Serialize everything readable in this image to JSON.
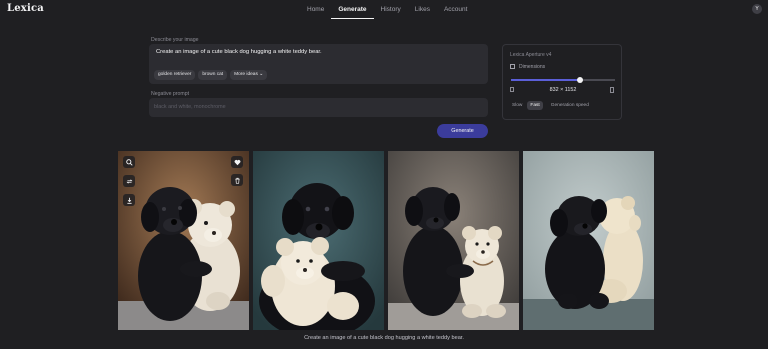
{
  "app": {
    "logo": "Lexica",
    "avatar_initial": "Y"
  },
  "nav": [
    {
      "label": "Home",
      "active": false
    },
    {
      "label": "Generate",
      "active": true
    },
    {
      "label": "History",
      "active": false
    },
    {
      "label": "Likes",
      "active": false
    },
    {
      "label": "Account",
      "active": false
    }
  ],
  "prompt": {
    "label": "Describe your image",
    "value": "Create an image of a cute black dog hugging a white teddy bear.",
    "chips": [
      "golden retriever",
      "brown cat",
      "More ideas"
    ]
  },
  "negative": {
    "label": "Negative prompt",
    "placeholder": "black and white, monochrome"
  },
  "generate_label": "Generate",
  "settings": {
    "model": "Lexica Aperture v4",
    "dimensions_label": "Dimensions",
    "dimensions_value": "832 × 1152",
    "slider_fraction": 0.66,
    "speed_options": [
      "Slow",
      "Fast"
    ],
    "speed_selected": "Fast",
    "speed_label": "Generation speed"
  },
  "gallery": {
    "image_count": 4,
    "caption": "Create an image of a cute black dog hugging a white teddy bear."
  },
  "icons": [
    "search-icon",
    "remix-icon",
    "download-icon",
    "heart-icon",
    "trash-icon",
    "chevron-down-icon",
    "dimensions-icon"
  ],
  "colors": {
    "accent": "#3b3c9c",
    "slider": "#5b5fd8",
    "background": "#1f1f22"
  }
}
